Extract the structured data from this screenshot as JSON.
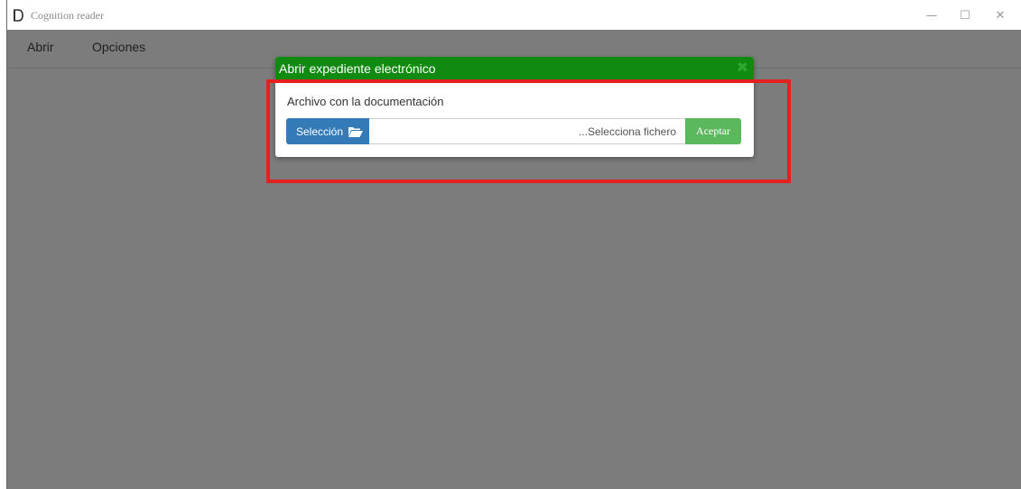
{
  "window": {
    "title": "Cognition reader",
    "controls": {
      "minimize": "—",
      "maximize": "☐",
      "close": "✕"
    }
  },
  "menu": {
    "items": [
      {
        "label": "Abrir"
      },
      {
        "label": "Opciones"
      }
    ]
  },
  "dialog": {
    "title": "Abrir expediente electrónico",
    "close_glyph": "✖",
    "field_label": "Archivo con la documentación",
    "select_button": "Selección",
    "file_placeholder": "...Selecciona fichero",
    "accept_button": "Aceptar",
    "colors": {
      "header": "#118a11",
      "select": "#337ab7",
      "accept": "#5cb85c"
    }
  },
  "annotation": {
    "color": "#e42020"
  }
}
